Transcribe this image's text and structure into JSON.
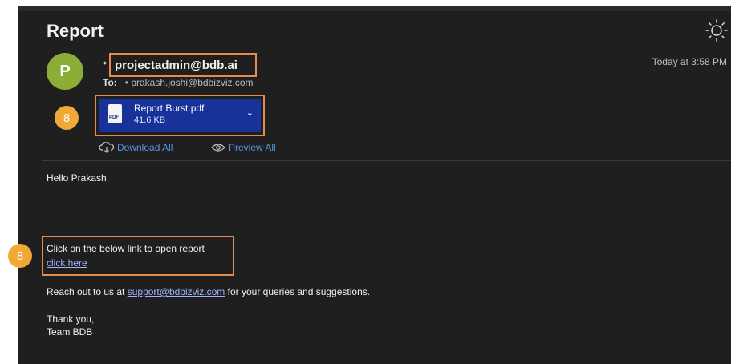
{
  "email": {
    "subject": "Report",
    "avatar_letter": "P",
    "sender": "projectadmin@bdb.ai",
    "to_label": "To:",
    "recipient": "prakash.joshi@bdbizviz.com",
    "timestamp": "Today at 3:58 PM",
    "attachment": {
      "name": "Report Burst.pdf",
      "size": "41.6 KB",
      "icon_text": "PDF"
    },
    "download_all": "Download All",
    "preview_all": "Preview All",
    "body": {
      "greeting": "Hello Prakash,",
      "instruction": "Click on the below link to open report",
      "link_text": "click here",
      "reach_out_prefix": "Reach out to us at ",
      "support_email": "support@bdbizviz.com",
      "reach_out_suffix": " for your queries and suggestions.",
      "closing": "Thank you,",
      "signature": "Team BDB"
    }
  },
  "callouts": {
    "attachment_badge": "8",
    "link_badge": "8"
  },
  "colors": {
    "background": "#1f1f1f",
    "highlight_border": "#e8894e",
    "badge": "#f0a837",
    "attachment_bg": "#17339a",
    "avatar": "#8cae36",
    "link": "#9fb2ff"
  },
  "icons": [
    "sun-icon",
    "pdf-file-icon",
    "chevron-down-icon",
    "cloud-download-icon",
    "eye-icon"
  ]
}
